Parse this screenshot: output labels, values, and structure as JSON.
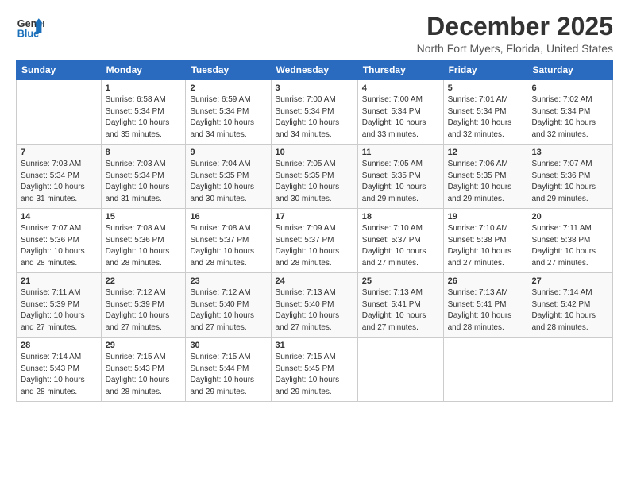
{
  "logo": {
    "line1": "General",
    "line2": "Blue"
  },
  "title": "December 2025",
  "subtitle": "North Fort Myers, Florida, United States",
  "weekdays": [
    "Sunday",
    "Monday",
    "Tuesday",
    "Wednesday",
    "Thursday",
    "Friday",
    "Saturday"
  ],
  "weeks": [
    [
      {
        "day": "",
        "info": ""
      },
      {
        "day": "1",
        "info": "Sunrise: 6:58 AM\nSunset: 5:34 PM\nDaylight: 10 hours\nand 35 minutes."
      },
      {
        "day": "2",
        "info": "Sunrise: 6:59 AM\nSunset: 5:34 PM\nDaylight: 10 hours\nand 34 minutes."
      },
      {
        "day": "3",
        "info": "Sunrise: 7:00 AM\nSunset: 5:34 PM\nDaylight: 10 hours\nand 34 minutes."
      },
      {
        "day": "4",
        "info": "Sunrise: 7:00 AM\nSunset: 5:34 PM\nDaylight: 10 hours\nand 33 minutes."
      },
      {
        "day": "5",
        "info": "Sunrise: 7:01 AM\nSunset: 5:34 PM\nDaylight: 10 hours\nand 32 minutes."
      },
      {
        "day": "6",
        "info": "Sunrise: 7:02 AM\nSunset: 5:34 PM\nDaylight: 10 hours\nand 32 minutes."
      }
    ],
    [
      {
        "day": "7",
        "info": "Sunrise: 7:03 AM\nSunset: 5:34 PM\nDaylight: 10 hours\nand 31 minutes."
      },
      {
        "day": "8",
        "info": "Sunrise: 7:03 AM\nSunset: 5:34 PM\nDaylight: 10 hours\nand 31 minutes."
      },
      {
        "day": "9",
        "info": "Sunrise: 7:04 AM\nSunset: 5:35 PM\nDaylight: 10 hours\nand 30 minutes."
      },
      {
        "day": "10",
        "info": "Sunrise: 7:05 AM\nSunset: 5:35 PM\nDaylight: 10 hours\nand 30 minutes."
      },
      {
        "day": "11",
        "info": "Sunrise: 7:05 AM\nSunset: 5:35 PM\nDaylight: 10 hours\nand 29 minutes."
      },
      {
        "day": "12",
        "info": "Sunrise: 7:06 AM\nSunset: 5:35 PM\nDaylight: 10 hours\nand 29 minutes."
      },
      {
        "day": "13",
        "info": "Sunrise: 7:07 AM\nSunset: 5:36 PM\nDaylight: 10 hours\nand 29 minutes."
      }
    ],
    [
      {
        "day": "14",
        "info": "Sunrise: 7:07 AM\nSunset: 5:36 PM\nDaylight: 10 hours\nand 28 minutes."
      },
      {
        "day": "15",
        "info": "Sunrise: 7:08 AM\nSunset: 5:36 PM\nDaylight: 10 hours\nand 28 minutes."
      },
      {
        "day": "16",
        "info": "Sunrise: 7:08 AM\nSunset: 5:37 PM\nDaylight: 10 hours\nand 28 minutes."
      },
      {
        "day": "17",
        "info": "Sunrise: 7:09 AM\nSunset: 5:37 PM\nDaylight: 10 hours\nand 28 minutes."
      },
      {
        "day": "18",
        "info": "Sunrise: 7:10 AM\nSunset: 5:37 PM\nDaylight: 10 hours\nand 27 minutes."
      },
      {
        "day": "19",
        "info": "Sunrise: 7:10 AM\nSunset: 5:38 PM\nDaylight: 10 hours\nand 27 minutes."
      },
      {
        "day": "20",
        "info": "Sunrise: 7:11 AM\nSunset: 5:38 PM\nDaylight: 10 hours\nand 27 minutes."
      }
    ],
    [
      {
        "day": "21",
        "info": "Sunrise: 7:11 AM\nSunset: 5:39 PM\nDaylight: 10 hours\nand 27 minutes."
      },
      {
        "day": "22",
        "info": "Sunrise: 7:12 AM\nSunset: 5:39 PM\nDaylight: 10 hours\nand 27 minutes."
      },
      {
        "day": "23",
        "info": "Sunrise: 7:12 AM\nSunset: 5:40 PM\nDaylight: 10 hours\nand 27 minutes."
      },
      {
        "day": "24",
        "info": "Sunrise: 7:13 AM\nSunset: 5:40 PM\nDaylight: 10 hours\nand 27 minutes."
      },
      {
        "day": "25",
        "info": "Sunrise: 7:13 AM\nSunset: 5:41 PM\nDaylight: 10 hours\nand 27 minutes."
      },
      {
        "day": "26",
        "info": "Sunrise: 7:13 AM\nSunset: 5:41 PM\nDaylight: 10 hours\nand 28 minutes."
      },
      {
        "day": "27",
        "info": "Sunrise: 7:14 AM\nSunset: 5:42 PM\nDaylight: 10 hours\nand 28 minutes."
      }
    ],
    [
      {
        "day": "28",
        "info": "Sunrise: 7:14 AM\nSunset: 5:43 PM\nDaylight: 10 hours\nand 28 minutes."
      },
      {
        "day": "29",
        "info": "Sunrise: 7:15 AM\nSunset: 5:43 PM\nDaylight: 10 hours\nand 28 minutes."
      },
      {
        "day": "30",
        "info": "Sunrise: 7:15 AM\nSunset: 5:44 PM\nDaylight: 10 hours\nand 29 minutes."
      },
      {
        "day": "31",
        "info": "Sunrise: 7:15 AM\nSunset: 5:45 PM\nDaylight: 10 hours\nand 29 minutes."
      },
      {
        "day": "",
        "info": ""
      },
      {
        "day": "",
        "info": ""
      },
      {
        "day": "",
        "info": ""
      }
    ]
  ]
}
